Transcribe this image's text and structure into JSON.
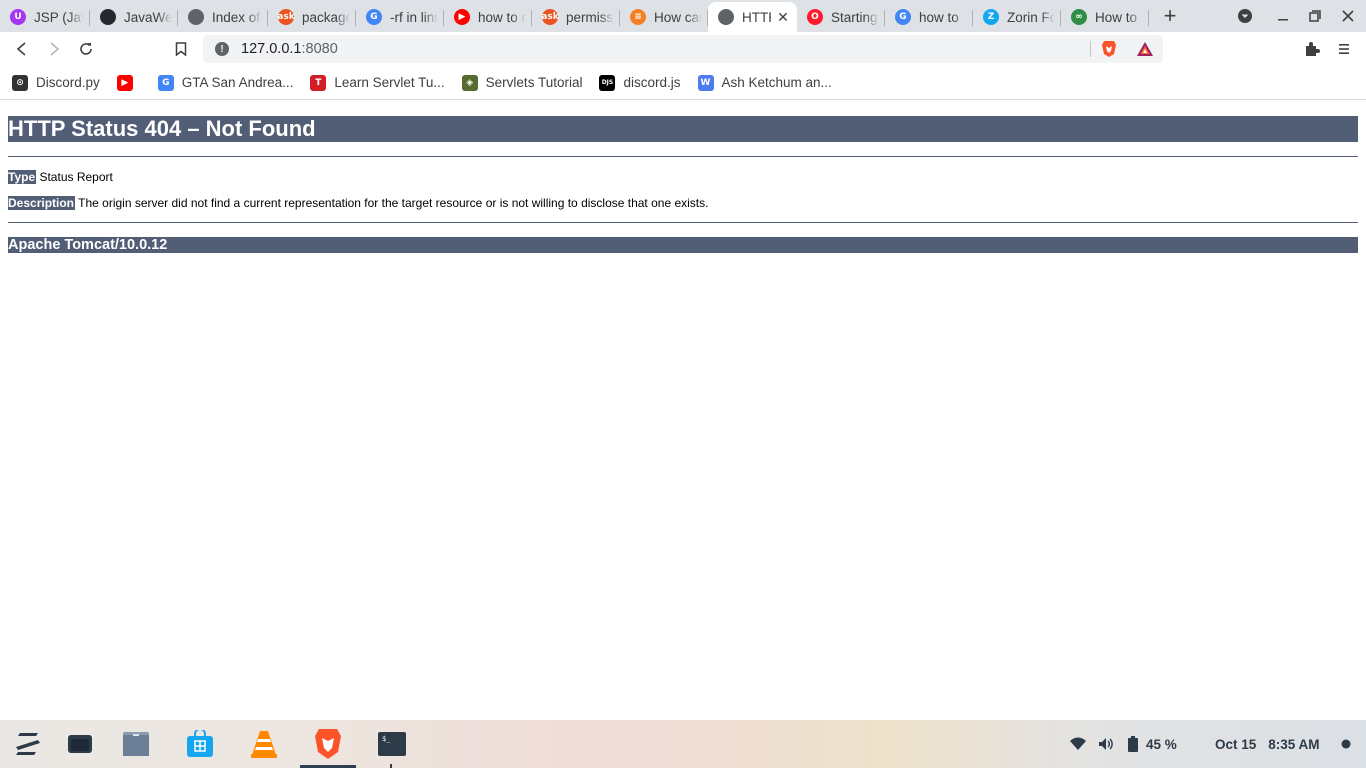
{
  "browser": {
    "tabs": [
      {
        "title": "JSP (JavaWeb)",
        "icon": "udemy-icon",
        "color": "#a435f0",
        "glyph": "U",
        "width": 90
      },
      {
        "title": "JavaWeb",
        "icon": "github-icon",
        "color": "#24292e",
        "glyph": "",
        "width": 88
      },
      {
        "title": "Index of",
        "icon": "globe-icon",
        "color": "#5f6368",
        "glyph": "",
        "width": 90
      },
      {
        "title": "package",
        "icon": "askubuntu-icon",
        "color": "#e95420",
        "glyph": "ask",
        "width": 88
      },
      {
        "title": "-rf in linux",
        "icon": "google-icon",
        "color": "#4285f4",
        "glyph": "G",
        "width": 88
      },
      {
        "title": "how to run",
        "icon": "youtube-icon",
        "color": "#ff0000",
        "glyph": "▶",
        "width": 88
      },
      {
        "title": "permission",
        "icon": "askubuntu-icon",
        "color": "#e95420",
        "glyph": "ask",
        "width": 88
      },
      {
        "title": "How can",
        "icon": "stackoverflow-icon",
        "color": "#f48024",
        "glyph": "≡",
        "width": 88
      },
      {
        "title": "HTTP",
        "icon": "globe-icon",
        "color": "#5f6368",
        "glyph": "",
        "width": 89,
        "active": true
      },
      {
        "title": "Starting",
        "icon": "opera-icon",
        "color": "#ff1b2d",
        "glyph": "O",
        "width": 88
      },
      {
        "title": "how to",
        "icon": "google-icon",
        "color": "#4285f4",
        "glyph": "G",
        "width": 88
      },
      {
        "title": "Zorin Forum",
        "icon": "zorin-icon",
        "color": "#15a6f0",
        "glyph": "Z",
        "width": 88
      },
      {
        "title": "How to",
        "icon": "geeksforgeeks-icon",
        "color": "#2f8d46",
        "glyph": "∞",
        "width": 88
      }
    ],
    "address": {
      "host": "127.0.0.1",
      "port": ":8080"
    },
    "bookmarks": [
      {
        "label": "Discord.py",
        "icon": "discordpy-icon",
        "color": "#333333",
        "glyph": "⊙"
      },
      {
        "label": "",
        "icon": "youtube-icon",
        "color": "#ff0000",
        "glyph": "▶"
      },
      {
        "label": "GTA San Andrea...",
        "icon": "google-icon",
        "color": "#4285f4",
        "glyph": "G"
      },
      {
        "label": "Learn Servlet Tu...",
        "icon": "tutorialspoint-icon",
        "color": "#d01f28",
        "glyph": "T"
      },
      {
        "label": "Servlets Tutorial",
        "icon": "servlets-icon",
        "color": "#556b2f",
        "glyph": "◈"
      },
      {
        "label": "discord.js",
        "icon": "discordjs-icon",
        "color": "#000000",
        "glyph": "DJS"
      },
      {
        "label": "Ash Ketchum an...",
        "icon": "wiki-icon",
        "color": "#4d7cf0",
        "glyph": "W"
      }
    ]
  },
  "page": {
    "title": "HTTP Status 404 – Not Found",
    "type_label": "Type",
    "type_value": "Status Report",
    "desc_label": "Description",
    "desc_value": "The origin server did not find a current representation for the target resource or is not willing to disclose that one exists.",
    "footer": "Apache Tomcat/10.0.12"
  },
  "taskbar": {
    "battery": "45 %",
    "date": "Oct 15",
    "time": "8:35 AM"
  }
}
